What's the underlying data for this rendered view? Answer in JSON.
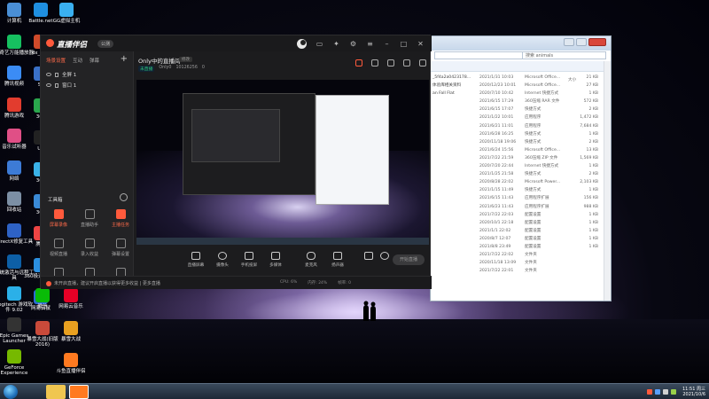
{
  "desktop": {
    "icons_col1": [
      {
        "label": "计算机",
        "color": "#4a8fd6"
      },
      {
        "label": "爱奇艺万能播放器",
        "color": "#16c060"
      },
      {
        "label": "腾讯视频",
        "color": "#3b8cf5"
      },
      {
        "label": "腾讯游戏",
        "color": "#e23c2e"
      },
      {
        "label": "音乐试听器",
        "color": "#e04f86"
      },
      {
        "label": "网络",
        "color": "#3d7bd6"
      },
      {
        "label": "回收站",
        "color": "#7c8fa4"
      },
      {
        "label": "DirectX修复工具",
        "color": "#2e62c5"
      },
      {
        "label": "系统激活与远程工具",
        "color": "#0d5fa6"
      },
      {
        "label": "Logitech 游戏软件 9.02",
        "color": "#2bb0e8"
      },
      {
        "label": "Epic Games Launcher",
        "color": "#333333"
      },
      {
        "label": "GeForce Experience",
        "color": "#76b900"
      }
    ],
    "icons_col2": [
      {
        "label": "Battle.net",
        "color": "#1f8fe0"
      },
      {
        "label": "dx_yy...",
        "color": "#d04a2a"
      },
      {
        "label": "Sc",
        "color": "#3a70c8"
      },
      {
        "label": "360",
        "color": "#2aa74d"
      },
      {
        "label": "Un",
        "color": "#222222"
      },
      {
        "label": "360",
        "color": "#3ab2e8"
      },
      {
        "label": "360",
        "color": "#3a8ad6"
      },
      {
        "label": "腾讯",
        "color": "#e44"
      },
      {
        "label": "360极速浏览器",
        "color": "#2b8fe0"
      },
      {
        "label": "网易云鼠",
        "color": "#2c6bd6"
      }
    ],
    "icons_col3": [
      {
        "label": "GG虚拟主机",
        "color": "#3ab0f0"
      },
      {
        "label": "网易云音乐",
        "color": "#e60026"
      },
      {
        "label": "暴雪大战",
        "color": "#e8a020"
      },
      {
        "label": "斗鱼直播伴侣",
        "color": "#ff7a20"
      }
    ],
    "icons_row_bottom": [
      {
        "label": "微信",
        "color": "#09bb07"
      },
      {
        "label": "暴雪大战(旧版2016)",
        "color": "#c94a3a"
      }
    ]
  },
  "app": {
    "logo": "直播伴侣",
    "version": "公测",
    "sidebar": {
      "tabs": [
        "场景设置",
        "互动",
        "弹幕"
      ],
      "plus_label": "+",
      "scenes": [
        "全屏 1",
        "窗口 1"
      ],
      "tools_title": "工具箱",
      "tools": [
        {
          "label": "屏幕录像",
          "hot": true
        },
        {
          "label": "直播助手",
          "hot": false
        },
        {
          "label": "主播任务",
          "hot": true
        },
        {
          "label": "视频直播",
          "hot": false
        },
        {
          "label": "录入收益",
          "hot": false
        },
        {
          "label": "弹幕设置",
          "hot": false
        },
        {
          "label": "虚拟形象",
          "hot": false
        },
        {
          "label": "弹幕姬",
          "hot": false
        },
        {
          "label": "影视助手",
          "hot": false
        }
      ]
    },
    "header": {
      "room_title": "Only中的直播间",
      "edit_chip": "修改",
      "live_badge": "未直播",
      "room_id": "Only0",
      "room_number": "10126256",
      "viewers": "0"
    },
    "controls": [
      {
        "label": "直播屏幕"
      },
      {
        "label": "摄像头"
      },
      {
        "label": "手机投屏"
      },
      {
        "label": "多媒体"
      },
      {
        "label": "麦克风"
      },
      {
        "label": "扬声器"
      }
    ],
    "start_button": "开始直播",
    "status": {
      "message": "未开启直播，建议开启直播以获得更多收益 | 更多直播",
      "indicators": [
        "CPU: 6%",
        "内存: 24%",
        "帧率: 0"
      ]
    }
  },
  "explorer": {
    "search_placeholder": "搜索 animals",
    "size_header": "大小",
    "rows": [
      {
        "name": "_5f4a2a0423178...",
        "date": "2021/1/31 10:03",
        "type": "Microsoft Office...",
        "size": "21 KB"
      },
      {
        "name": "体验库相关资料",
        "date": "2020/12/23 10:01",
        "type": "Microsoft Office...",
        "size": "27 KB"
      },
      {
        "name": "an Fall Flat",
        "date": "2020/7/10 10:42",
        "type": "Internet 快捷方式",
        "size": "1 KB"
      },
      {
        "name": "",
        "date": "2021/6/15 17:29",
        "type": "360压缩 RAR 文件",
        "size": "572 KB"
      },
      {
        "name": "",
        "date": "2021/6/15 17:07",
        "type": "快捷方式",
        "size": "2 KB"
      },
      {
        "name": "",
        "date": "2021/1/22 10:01",
        "type": "应用程序",
        "size": "1,472 KB"
      },
      {
        "name": "",
        "date": "2021/6/21 11:01",
        "type": "应用程序",
        "size": "7,684 KB"
      },
      {
        "name": "",
        "date": "2021/6/28 16:25",
        "type": "快捷方式",
        "size": "1 KB"
      },
      {
        "name": "",
        "date": "2020/11/18 19:06",
        "type": "快捷方式",
        "size": "2 KB"
      },
      {
        "name": "",
        "date": "2021/6/24 15:56",
        "type": "Microsoft Office...",
        "size": "13 KB"
      },
      {
        "name": "",
        "date": "2021/7/22 21:59",
        "type": "360压缩 ZIP 文件",
        "size": "1,569 KB"
      },
      {
        "name": "",
        "date": "2020/7/20 22:44",
        "type": "Internet 快捷方式",
        "size": "1 KB"
      },
      {
        "name": "",
        "date": "2021/1/25 21:58",
        "type": "快捷方式",
        "size": "2 KB"
      },
      {
        "name": "",
        "date": "2020/8/28 22:02",
        "type": "Microsoft Power...",
        "size": "2,103 KB"
      },
      {
        "name": "",
        "date": "2021/1/15 11:49",
        "type": "快捷方式",
        "size": "1 KB"
      },
      {
        "name": "",
        "date": "2021/6/15 11:43",
        "type": "应用程序扩展",
        "size": "156 KB"
      },
      {
        "name": "",
        "date": "2021/6/23 11:43",
        "type": "应用程序扩展",
        "size": "988 KB"
      },
      {
        "name": "",
        "date": "2021/7/22 22:03",
        "type": "配置设置",
        "size": "1 KB"
      },
      {
        "name": "",
        "date": "2020/10/1 22:18",
        "type": "配置设置",
        "size": "1 KB"
      },
      {
        "name": "",
        "date": "2021/1/1 22:02",
        "type": "配置设置",
        "size": "1 KB"
      },
      {
        "name": "",
        "date": "2020/8/7 12:07",
        "type": "配置设置",
        "size": "1 KB"
      },
      {
        "name": "",
        "date": "2021/8/8 23:49",
        "type": "配置设置",
        "size": "1 KB"
      },
      {
        "name": "",
        "date": "2021/7/22 22:02",
        "type": "文件夹",
        "size": ""
      },
      {
        "name": "",
        "date": "2020/11/18 13:09",
        "type": "文件夹",
        "size": ""
      },
      {
        "name": "",
        "date": "2021/7/22 22:01",
        "type": "文件夹",
        "size": ""
      }
    ]
  },
  "taskbar": {
    "time": "11:51 周三",
    "date": "2021/10/6"
  }
}
